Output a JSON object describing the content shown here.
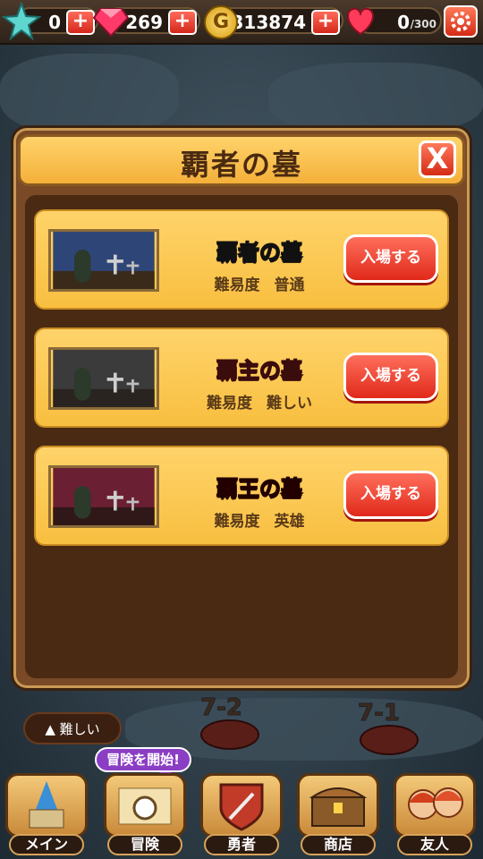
{
  "topbar": {
    "stars": "0",
    "gems": "269",
    "gold": "313874",
    "gold_symbol": "G",
    "hearts": "0",
    "hearts_max": "/300",
    "icons": [
      "star-icon",
      "gem-icon",
      "gold-coin-icon",
      "heart-icon",
      "gear-icon"
    ]
  },
  "modal": {
    "title": "覇者の墓",
    "close_label": "X",
    "dungeons": [
      {
        "name": "覇者の墓",
        "difficulty_label": "難易度",
        "difficulty": "普通",
        "enter_label": "入場する",
        "theme": "#2b3f6b"
      },
      {
        "name": "覇主の墓",
        "difficulty_label": "難易度",
        "difficulty": "難しい",
        "enter_label": "入場する",
        "theme": "#3a3a3a"
      },
      {
        "name": "覇王の墓",
        "difficulty_label": "難易度",
        "difficulty": "英雄",
        "enter_label": "入場する",
        "theme": "#6a1e30"
      }
    ]
  },
  "map": {
    "difficulty_toggle": "▲ 難しい",
    "stages": [
      "7-2",
      "7-1"
    ]
  },
  "nav": {
    "bubble": "冒険を開始!",
    "items": [
      "メイン",
      "冒険",
      "勇者",
      "商店",
      "友人"
    ]
  }
}
